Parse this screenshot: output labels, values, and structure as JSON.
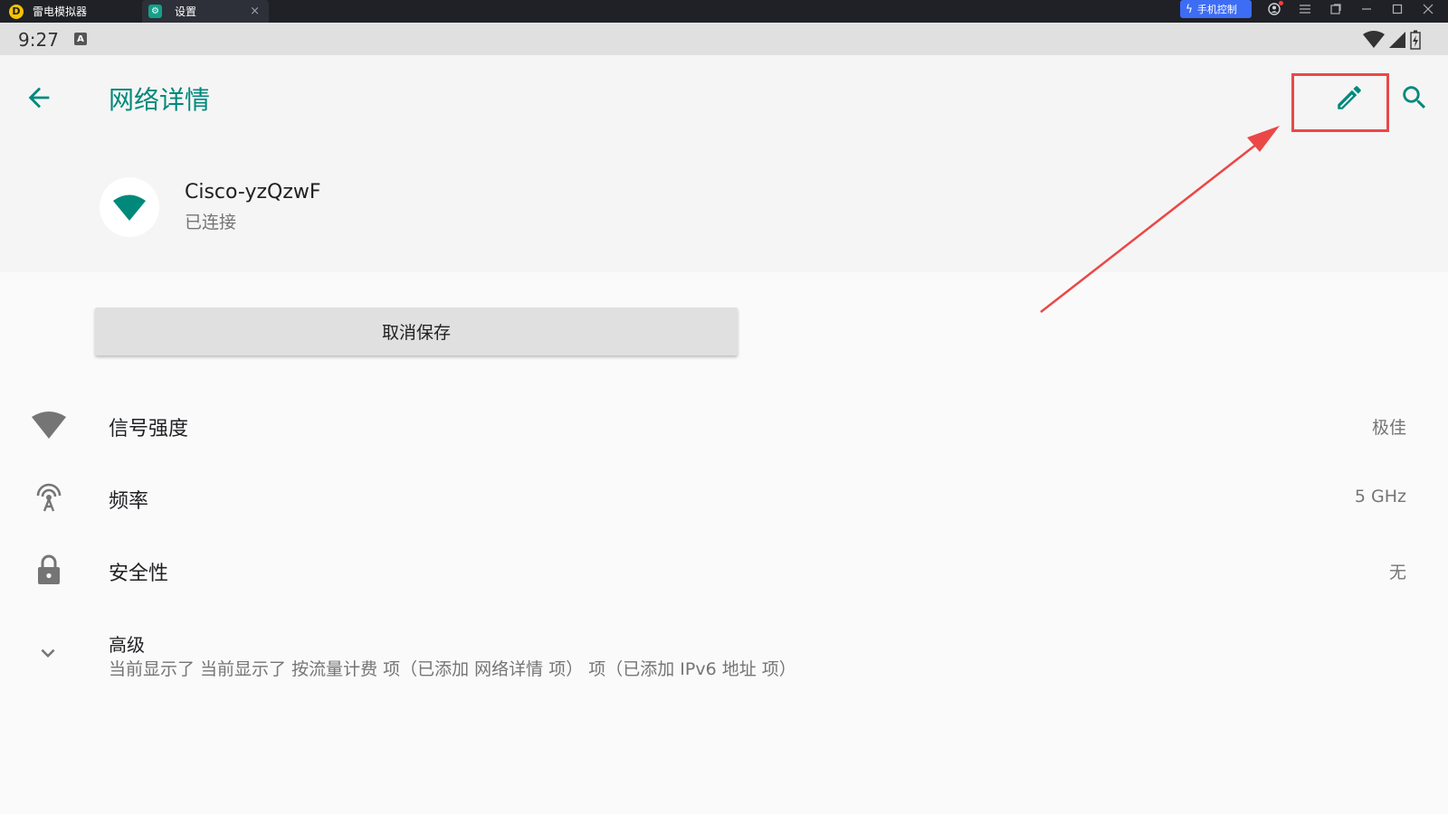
{
  "window": {
    "tabs": [
      {
        "label": "雷电模拟器"
      },
      {
        "label": "设置"
      }
    ],
    "phone_control_label": "手机控制",
    "close_tab_glyph": "×"
  },
  "status_bar": {
    "time": "9:27",
    "notification_badge": "A"
  },
  "header": {
    "title": "网络详情",
    "network_name": "Cisco-yzQzwF",
    "network_status": "已连接"
  },
  "actions": {
    "forget_label": "取消保存"
  },
  "details": [
    {
      "label": "信号强度",
      "value": "极佳",
      "icon": "wifi-signal-icon"
    },
    {
      "label": "频率",
      "value": "5 GHz",
      "icon": "antenna-icon"
    },
    {
      "label": "安全性",
      "value": "无",
      "icon": "lock-icon"
    }
  ],
  "advanced": {
    "title": "高级",
    "summary": "当前显示了 当前显示了 按流量计费 项（已添加 网络详情 项） 项（已添加 IPv6 地址 项）"
  },
  "colors": {
    "accent": "#00897b",
    "annotation": "#ec4747"
  }
}
